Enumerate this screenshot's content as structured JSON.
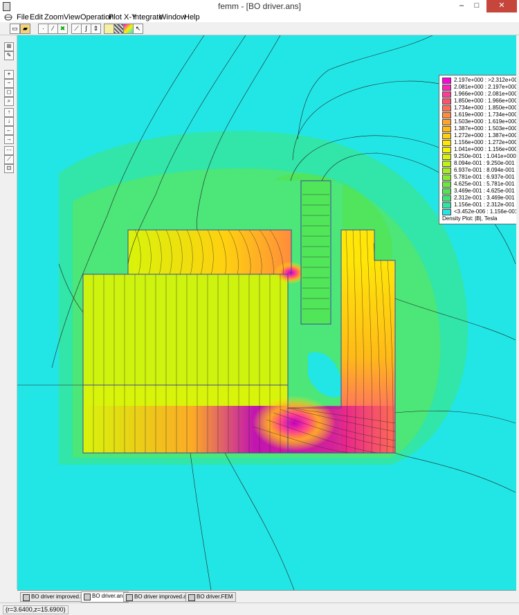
{
  "window": {
    "title": "femm - [BO driver.ans]",
    "minimize": "–",
    "maximize": "□",
    "close": "✕"
  },
  "menu": [
    "File",
    "Edit",
    "Zoom",
    "View",
    "Operation",
    "Plot X-Y",
    "Integrate",
    "Window",
    "Help"
  ],
  "mdi_buttons": [
    "–",
    "□",
    "×"
  ],
  "legend": {
    "caption": "Density Plot: |B|, Tesla",
    "entries": [
      {
        "label": "2.197e+000 : >2.312e+000",
        "color": "#ff00e0"
      },
      {
        "label": "2.081e+000 : 2.197e+000",
        "color": "#ff20b8"
      },
      {
        "label": "1.966e+000 : 2.081e+000",
        "color": "#ff3c94"
      },
      {
        "label": "1.850e+000 : 1.966e+000",
        "color": "#ff5070"
      },
      {
        "label": "1.734e+000 : 1.850e+000",
        "color": "#ff6e50"
      },
      {
        "label": "1.619e+000 : 1.734e+000",
        "color": "#ff8c3c"
      },
      {
        "label": "1.503e+000 : 1.619e+000",
        "color": "#ffa428"
      },
      {
        "label": "1.387e+000 : 1.503e+000",
        "color": "#ffba18"
      },
      {
        "label": "1.272e+000 : 1.387e+000",
        "color": "#ffd010"
      },
      {
        "label": "1.156e+000 : 1.272e+000",
        "color": "#ffe608"
      },
      {
        "label": "1.041e+000 : 1.156e+000",
        "color": "#f4f400"
      },
      {
        "label": "9.250e-001 : 1.041e+000",
        "color": "#d8f40a"
      },
      {
        "label": "8.094e-001 : 9.250e-001",
        "color": "#bcf414"
      },
      {
        "label": "6.937e-001 : 8.094e-001",
        "color": "#a2ee22"
      },
      {
        "label": "5.781e-001 : 6.937e-001",
        "color": "#86ea30"
      },
      {
        "label": "4.625e-001 : 5.781e-001",
        "color": "#6ce640"
      },
      {
        "label": "3.469e-001 : 4.625e-001",
        "color": "#52e456"
      },
      {
        "label": "2.312e-001 : 3.469e-001",
        "color": "#40e474"
      },
      {
        "label": "1.156e-001 : 2.312e-001",
        "color": "#30e4a4"
      },
      {
        "label": "<3.452e-006 : 1.156e-001",
        "color": "#22e6e6"
      }
    ]
  },
  "tabs": [
    {
      "label": "BO driver improved.FEM",
      "active": false
    },
    {
      "label": "BO driver.ans",
      "active": true
    },
    {
      "label": "BO driver improved.ans",
      "active": false
    },
    {
      "label": "BO driver.FEM",
      "active": false
    }
  ],
  "status": {
    "coords": "(r=3.6400,z=15.6900)"
  },
  "colors": {
    "background": "#22e6e6",
    "low_field": "#70e4a0",
    "mid_field": "#d8f40a",
    "high_field": "#c000c0"
  }
}
